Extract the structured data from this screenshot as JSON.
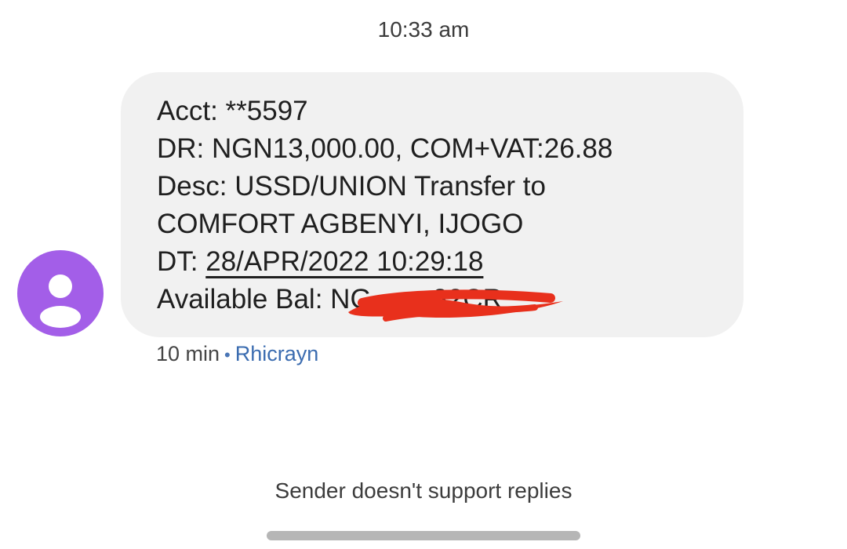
{
  "conversation": {
    "timestamp": "10:33 am",
    "message": {
      "account_line": "Acct: **5597",
      "debit_line": "DR: NGN13,000.00, COM+VAT:26.88",
      "desc_line": "Desc: USSD/UNION Transfer to",
      "desc_line_2": "COMFORT AGBENYI, IJOGO",
      "date_prefix": "DT: ",
      "date_value": "28/APR/2022 10:29:18",
      "balance_label": "Available Bal: ",
      "balance_visible_fragment": "NG        82CR"
    },
    "meta": {
      "age": "10 min",
      "separator": "•",
      "sender": "Rhicrayn"
    },
    "reply_notice": "Sender doesn't support replies"
  },
  "colors": {
    "avatar": "#a35ee8",
    "bubble": "#f1f1f1",
    "link": "#3b6cb0",
    "redaction": "#e8301c"
  },
  "icons": {
    "avatar": "person-icon"
  }
}
